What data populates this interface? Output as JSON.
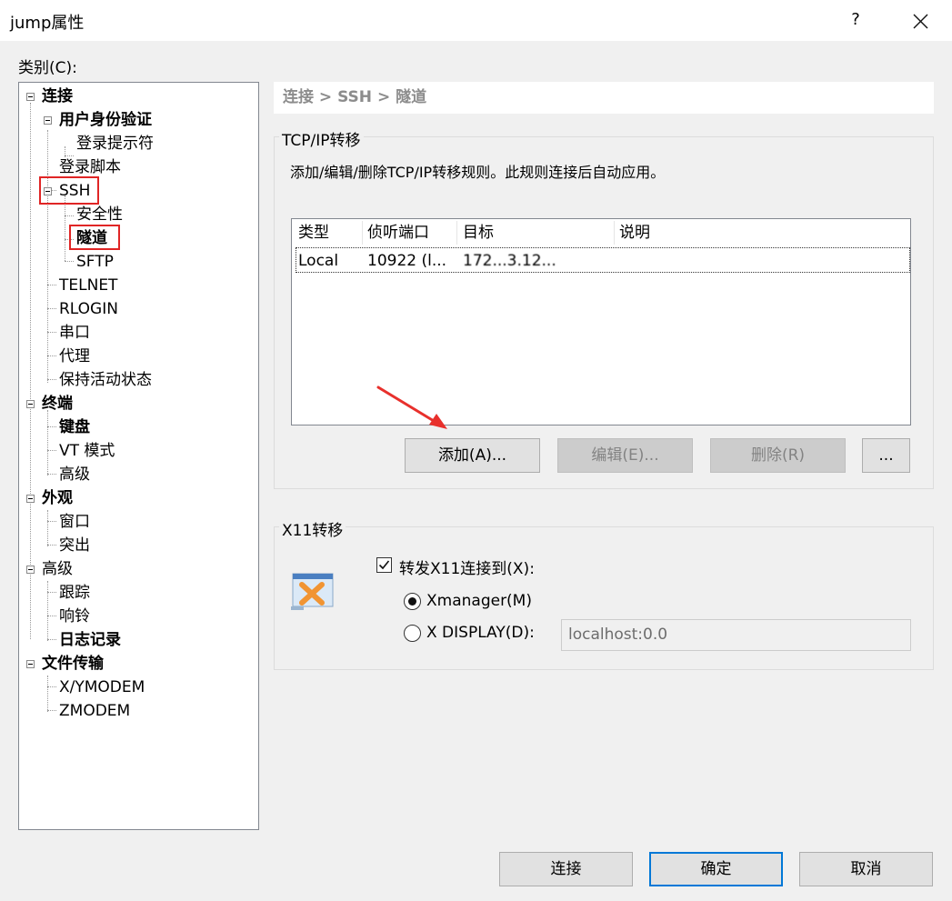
{
  "window": {
    "title": "jump属性",
    "help": "?",
    "close": "close"
  },
  "category_label": "类别(C):",
  "tree": [
    {
      "label": "连接",
      "bold": true
    },
    {
      "label": "用户身份验证",
      "bold": true
    },
    {
      "label": "登录提示符",
      "bold": false
    },
    {
      "label": "登录脚本",
      "bold": false
    },
    {
      "label": "SSH",
      "bold": false
    },
    {
      "label": "安全性",
      "bold": false
    },
    {
      "label": "隧道",
      "bold": true
    },
    {
      "label": "SFTP",
      "bold": false
    },
    {
      "label": "TELNET",
      "bold": false
    },
    {
      "label": "RLOGIN",
      "bold": false
    },
    {
      "label": "串口",
      "bold": false
    },
    {
      "label": "代理",
      "bold": false
    },
    {
      "label": "保持活动状态",
      "bold": false
    },
    {
      "label": "终端",
      "bold": true
    },
    {
      "label": "键盘",
      "bold": true
    },
    {
      "label": "VT 模式",
      "bold": false
    },
    {
      "label": "高级",
      "bold": false
    },
    {
      "label": "外观",
      "bold": true
    },
    {
      "label": "窗口",
      "bold": false
    },
    {
      "label": "突出",
      "bold": false
    },
    {
      "label": "高级",
      "bold": false
    },
    {
      "label": "跟踪",
      "bold": false
    },
    {
      "label": "响铃",
      "bold": false
    },
    {
      "label": "日志记录",
      "bold": true
    },
    {
      "label": "文件传输",
      "bold": true
    },
    {
      "label": "X/YMODEM",
      "bold": false
    },
    {
      "label": "ZMODEM",
      "bold": false
    }
  ],
  "breadcrumb": "连接 > SSH > 隧道",
  "tcpip": {
    "title": "TCP/IP转移",
    "description": "添加/编辑/删除TCP/IP转移规则。此规则连接后自动应用。",
    "columns": [
      "类型",
      "侦听端口",
      "目标",
      "说明"
    ],
    "rows": [
      {
        "type": "Local",
        "listen_port": "10922 (l...",
        "target": "1⁠7⁠2.⁠⁠⁠.⁠⁠.⁠⁠3.12...",
        "note": ""
      }
    ],
    "buttons": {
      "add": "添加(A)...",
      "edit": "编辑(E)...",
      "delete": "删除(R)",
      "more": "..."
    }
  },
  "x11": {
    "title": "X11转移",
    "forward_label": "转发X11连接到(X):",
    "forward_checked": true,
    "xmanager_label": "Xmanager(M)",
    "xdisplay_label": "X DISPLAY(D):",
    "selected": "Xmanager(M)",
    "display_value": "localhost:0.0"
  },
  "footer": {
    "connect": "连接",
    "ok": "确定",
    "cancel": "取消"
  },
  "colors": {
    "highlight": "#e02525",
    "accent": "#0078d7",
    "arrow": "#e8302c"
  }
}
